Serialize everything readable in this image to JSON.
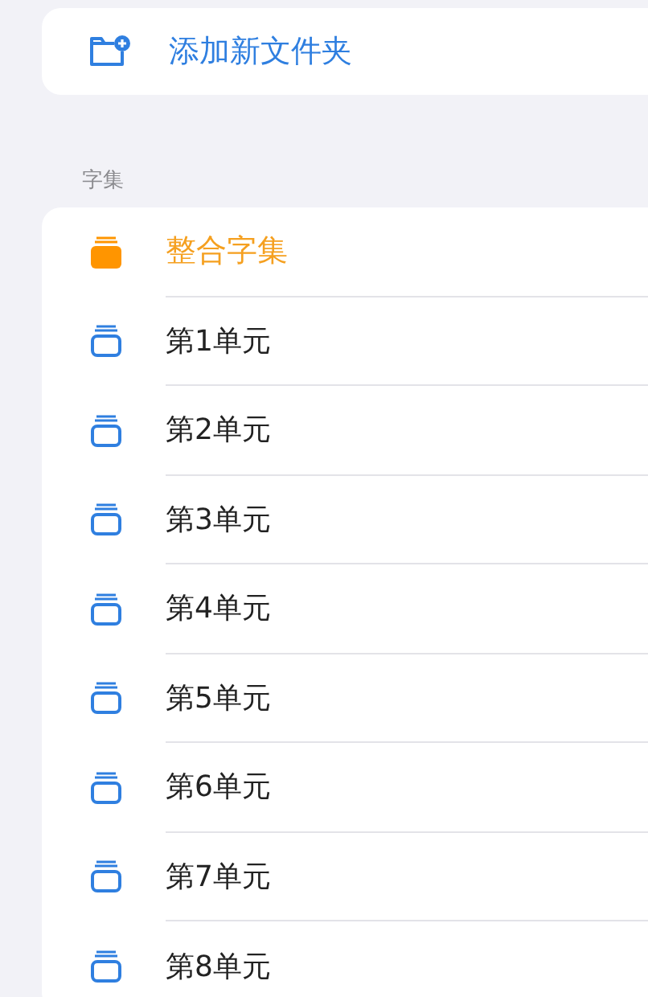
{
  "add_folder": {
    "label": "添加新文件夹"
  },
  "section": {
    "title": "字集",
    "items": [
      {
        "label": "整合字集",
        "selected": true
      },
      {
        "label": "第1单元",
        "selected": false
      },
      {
        "label": "第2单元",
        "selected": false
      },
      {
        "label": "第3单元",
        "selected": false
      },
      {
        "label": "第4单元",
        "selected": false
      },
      {
        "label": "第5单元",
        "selected": false
      },
      {
        "label": "第6单元",
        "selected": false
      },
      {
        "label": "第7单元",
        "selected": false
      },
      {
        "label": "第8单元",
        "selected": false
      }
    ]
  }
}
